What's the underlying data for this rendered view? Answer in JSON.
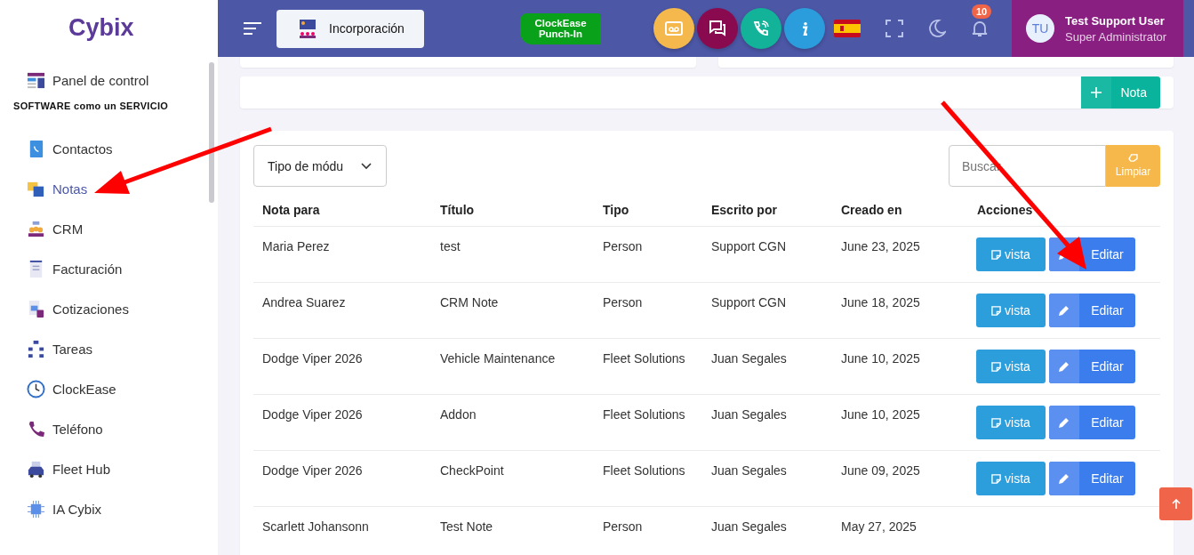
{
  "sidebar": {
    "logo": "Cybix",
    "top_item": {
      "label": "Panel de control",
      "selected": false
    },
    "section_heading": "SOFTWARE como un SERVICIO",
    "items": [
      {
        "label": "Contactos",
        "selected": false
      },
      {
        "label": "Notas",
        "selected": true
      },
      {
        "label": "CRM",
        "selected": false
      },
      {
        "label": "Facturación",
        "selected": false
      },
      {
        "label": "Cotizaciones",
        "selected": false
      },
      {
        "label": "Tareas",
        "selected": false
      },
      {
        "label": "ClockEase",
        "selected": false
      },
      {
        "label": "Teléfono",
        "selected": false
      },
      {
        "label": "Fleet Hub",
        "selected": false
      },
      {
        "label": "IA Cybix",
        "selected": false
      }
    ]
  },
  "topbar": {
    "onboarding_button": "Incorporación",
    "punch_in_lines": [
      "ClockEase",
      "Punch-In"
    ],
    "notification_count": "10",
    "user": {
      "initials": "TU",
      "name": "Test Support User",
      "role": "Super Administrator"
    }
  },
  "note_button": "Nota",
  "filters": {
    "module_type": {
      "value": "Tipo de módu"
    },
    "search": {
      "placeholder": "Buscar"
    },
    "clear_button": "Limpiar"
  },
  "table": {
    "columns": [
      "Nota para",
      "Título",
      "Tipo",
      "Escrito por",
      "Creado en",
      "Acciones"
    ],
    "rows": [
      {
        "cells": [
          "Maria Perez",
          "test",
          "Person",
          "Support CGN",
          "June 23, 2025"
        ],
        "view": "vista",
        "edit": "Editar"
      },
      {
        "cells": [
          "Andrea Suarez",
          "CRM Note",
          "Person",
          "Support CGN",
          "June 18, 2025"
        ],
        "view": "vista",
        "edit": "Editar"
      },
      {
        "cells": [
          "Dodge Viper 2026",
          "Vehicle Maintenance",
          "Fleet Solutions",
          "Juan Segales",
          "June 10, 2025"
        ],
        "view": "vista",
        "edit": "Editar"
      },
      {
        "cells": [
          "Dodge Viper 2026",
          "Addon",
          "Fleet Solutions",
          "Juan Segales",
          "June 10, 2025"
        ],
        "view": "vista",
        "edit": "Editar"
      },
      {
        "cells": [
          "Dodge Viper 2026",
          "CheckPoint",
          "Fleet Solutions",
          "Juan Segales",
          "June 09, 2025"
        ],
        "view": "vista",
        "edit": "Editar"
      },
      {
        "cells": [
          "Scarlett Johansonn",
          "Test Note",
          "Person",
          "Juan Segales",
          "May 27, 2025"
        ]
      }
    ]
  }
}
